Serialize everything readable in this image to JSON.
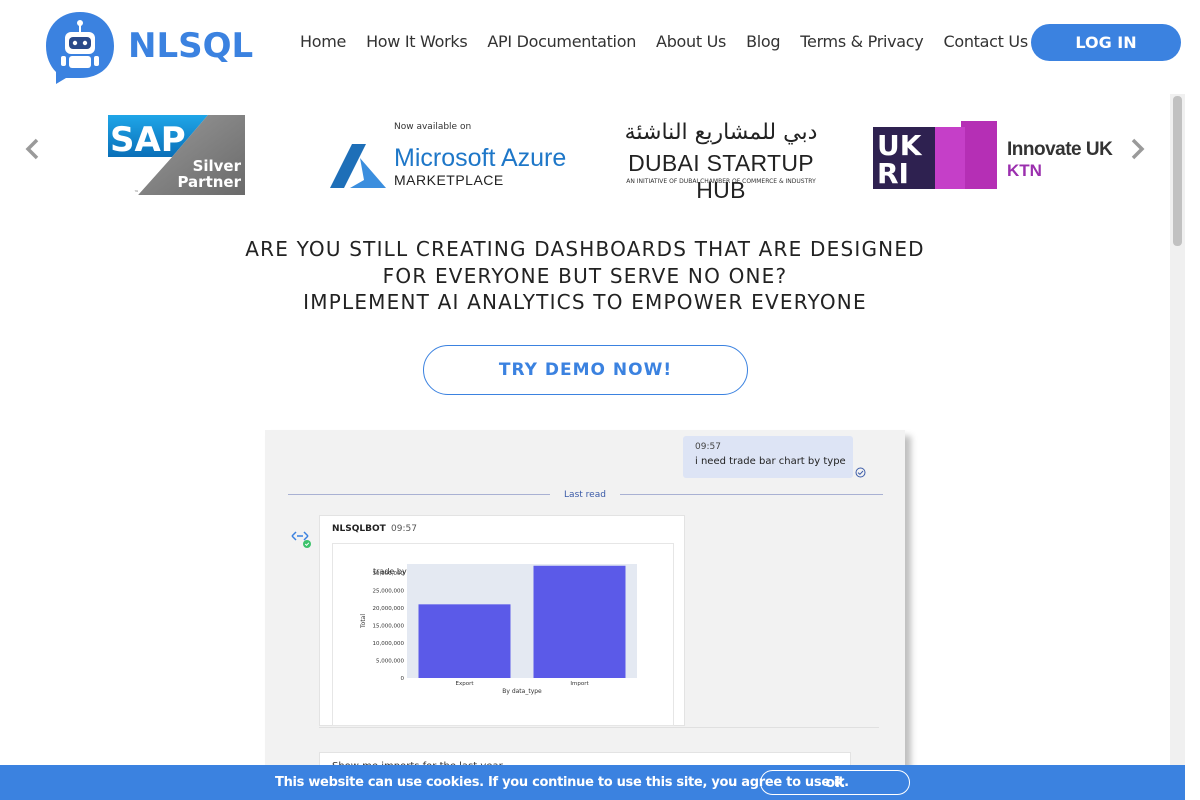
{
  "brand": {
    "name": "NLSQL",
    "color": "#3b82e0"
  },
  "nav": {
    "items": [
      "Home",
      "How It Works",
      "API Documentation",
      "About Us",
      "Blog",
      "Terms & Privacy",
      "Contact Us"
    ],
    "login_label": "LOG IN"
  },
  "partners": {
    "sap": {
      "logo_text": "SAP",
      "line1": "Silver",
      "line2": "Partner",
      "tm": "™"
    },
    "azure": {
      "small": "Now available on",
      "name": "Microsoft Azure",
      "sub": "MARKETPLACE"
    },
    "dubai": {
      "arabic": "دبي للمشاريع الناشئة",
      "name": "DUBAI STARTUP HUB",
      "sub": "AN INITIATIVE OF DUBAI CHAMBER OF COMMERCE & INDUSTRY"
    },
    "ukri": {
      "mark": "UKRI",
      "line1": "Innovate UK",
      "line2": "KTN"
    },
    "prev_icon": "chevron-left-icon",
    "next_icon": "chevron-right-icon"
  },
  "hero": {
    "lines": [
      "ARE YOU STILL CREATING DASHBOARDS THAT ARE DESIGNED",
      "FOR EVERYONE BUT SERVE NO ONE?",
      "IMPLEMENT AI ANALYTICS TO EMPOWER EVERYONE"
    ],
    "cta_label": "TRY DEMO NOW!"
  },
  "chat": {
    "user_message": {
      "time": "09:57",
      "text": "i need trade bar chart by type"
    },
    "last_read_label": "Last read",
    "bot_message": {
      "name": "NLSQLBOT",
      "time": "09:57"
    },
    "next_message_text": "Show me imports for the last year"
  },
  "chart_data": {
    "type": "bar",
    "title": "trade by `data_type`",
    "categories": [
      "Export",
      "Import"
    ],
    "values": [
      21000000,
      32000000
    ],
    "xlabel": "By data_type",
    "ylabel": "Total",
    "ylim": [
      0,
      32500000
    ],
    "yticks": [
      0,
      5000000,
      10000000,
      15000000,
      20000000,
      25000000,
      30000000
    ],
    "ytick_labels": [
      "0",
      "5,000,000",
      "10,000,000",
      "15,000,000",
      "20,000,000",
      "25,000,000",
      "30,000,000"
    ],
    "bar_color": "#5b5ae8",
    "plot_bg": "#e4e9f2"
  },
  "cookie": {
    "text": "This website can use cookies. If you continue to use this site, you agree to use it.",
    "ok_label": "ok"
  }
}
